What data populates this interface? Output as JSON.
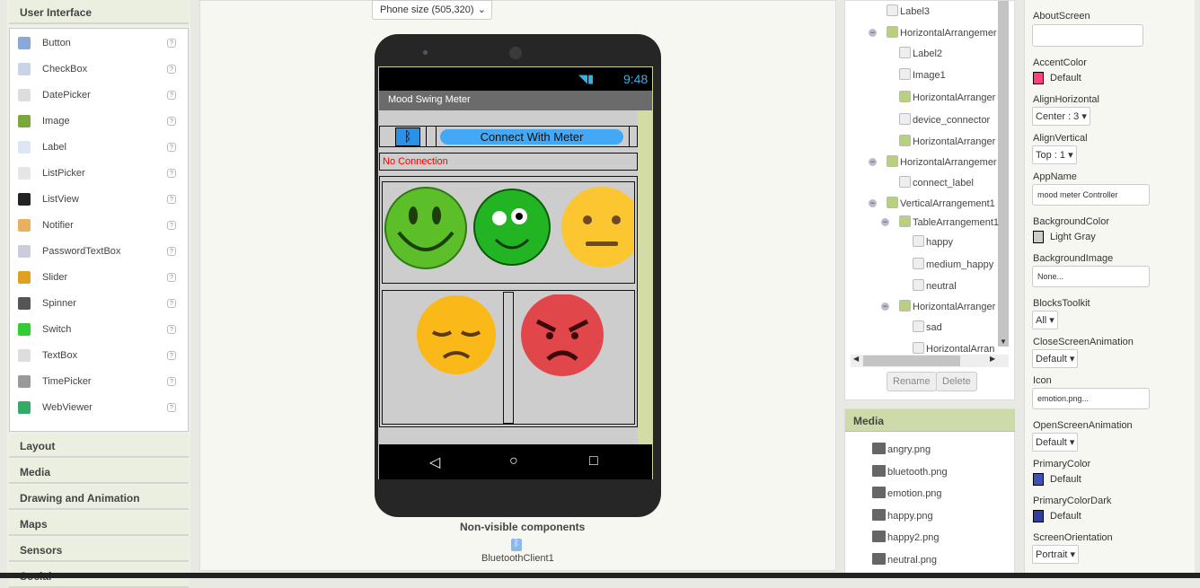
{
  "palette": {
    "header": "User Interface",
    "items": [
      {
        "label": "Button",
        "icon": "button-icon",
        "color": "#8aa8d8"
      },
      {
        "label": "CheckBox",
        "icon": "checkbox-icon",
        "color": "#c8d4e8"
      },
      {
        "label": "DatePicker",
        "icon": "datepicker-icon",
        "color": "#ddd"
      },
      {
        "label": "Image",
        "icon": "image-icon",
        "color": "#7aa83a"
      },
      {
        "label": "Label",
        "icon": "label-icon",
        "color": "#dde6f5"
      },
      {
        "label": "ListPicker",
        "icon": "listpicker-icon",
        "color": "#e6e6e6"
      },
      {
        "label": "ListView",
        "icon": "listview-icon",
        "color": "#222"
      },
      {
        "label": "Notifier",
        "icon": "notifier-icon",
        "color": "#e8b060"
      },
      {
        "label": "PasswordTextBox",
        "icon": "passwordtextbox-icon",
        "color": "#ccd"
      },
      {
        "label": "Slider",
        "icon": "slider-icon",
        "color": "#e0a020"
      },
      {
        "label": "Spinner",
        "icon": "spinner-icon",
        "color": "#555"
      },
      {
        "label": "Switch",
        "icon": "switch-icon",
        "color": "#3c3"
      },
      {
        "label": "TextBox",
        "icon": "textbox-icon",
        "color": "#ddd"
      },
      {
        "label": "TimePicker",
        "icon": "timepicker-icon",
        "color": "#999"
      },
      {
        "label": "WebViewer",
        "icon": "webviewer-icon",
        "color": "#3a6"
      }
    ],
    "help": "?",
    "categories": [
      "Layout",
      "Media",
      "Drawing and Animation",
      "Maps",
      "Sensors",
      "Social"
    ]
  },
  "viewer": {
    "size_select": "Phone size (505,320)",
    "status_time": "9:48",
    "app_title": "Mood Swing Meter",
    "connect_button": "Connect With Meter",
    "connection_status": "No Connection",
    "nonvisible_title": "Non-visible components",
    "nonvisible_items": [
      "BluetoothClient1"
    ]
  },
  "tree": {
    "items": [
      {
        "label": "Label3"
      },
      {
        "label": "HorizontalArrangemer"
      },
      {
        "label": "Label2"
      },
      {
        "label": "Image1"
      },
      {
        "label": "HorizontalArranger"
      },
      {
        "label": "device_connector"
      },
      {
        "label": "HorizontalArranger"
      },
      {
        "label": "HorizontalArrangemer"
      },
      {
        "label": "connect_label"
      },
      {
        "label": "VerticalArrangement1"
      },
      {
        "label": "TableArrangement1"
      },
      {
        "label": "happy"
      },
      {
        "label": "medium_happy"
      },
      {
        "label": "neutral"
      },
      {
        "label": "HorizontalArranger"
      },
      {
        "label": "sad"
      },
      {
        "label": "HorizontalArran"
      }
    ],
    "rename": "Rename",
    "delete": "Delete"
  },
  "media": {
    "header": "Media",
    "files": [
      "angry.png",
      "bluetooth.png",
      "emotion.png",
      "happy.png",
      "happy2.png",
      "neutral.png"
    ]
  },
  "properties": {
    "about_screen": {
      "label": "AboutScreen",
      "value": ""
    },
    "accent_color": {
      "label": "AccentColor",
      "value": "Default",
      "color": "#ff4081"
    },
    "align_horizontal": {
      "label": "AlignHorizontal",
      "value": "Center : 3"
    },
    "align_vertical": {
      "label": "AlignVertical",
      "value": "Top : 1"
    },
    "app_name": {
      "label": "AppName",
      "value": "mood meter Controller"
    },
    "background_color": {
      "label": "BackgroundColor",
      "value": "Light Gray",
      "color": "#cccccc"
    },
    "background_image": {
      "label": "BackgroundImage",
      "value": "None..."
    },
    "blocks_toolkit": {
      "label": "BlocksToolkit",
      "value": "All"
    },
    "close_screen_animation": {
      "label": "CloseScreenAnimation",
      "value": "Default"
    },
    "icon": {
      "label": "Icon",
      "value": "emotion.png..."
    },
    "open_screen_animation": {
      "label": "OpenScreenAnimation",
      "value": "Default"
    },
    "primary_color": {
      "label": "PrimaryColor",
      "value": "Default",
      "color": "#3f51b5"
    },
    "primary_color_dark": {
      "label": "PrimaryColorDark",
      "value": "Default",
      "color": "#303f9f"
    },
    "screen_orientation": {
      "label": "ScreenOrientation",
      "value": "Portrait"
    }
  }
}
